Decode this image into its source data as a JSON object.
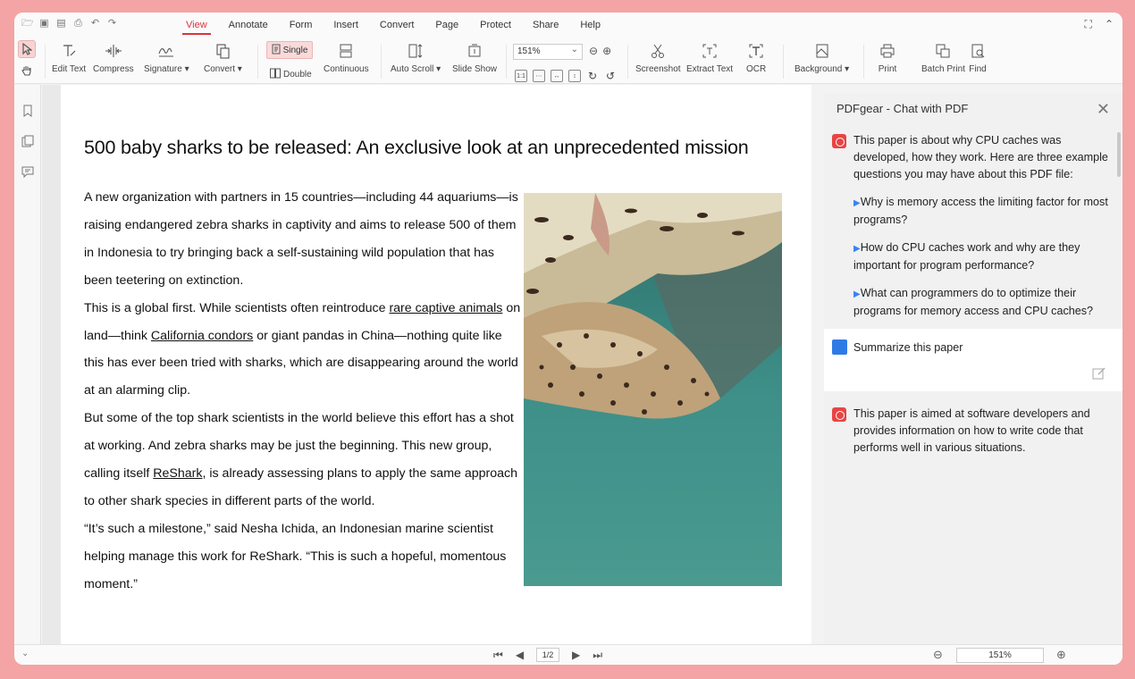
{
  "menubar": {
    "menus": [
      "View",
      "Annotate",
      "Form",
      "Insert",
      "Convert",
      "Page",
      "Protect",
      "Share",
      "Help"
    ],
    "active": "View"
  },
  "toolbar": {
    "edit_text": "Edit Text",
    "compress": "Compress",
    "signature": "Signature ▾",
    "convert": "Convert ▾",
    "single": "Single",
    "double": "Double",
    "continuous": "Continuous",
    "auto_scroll": "Auto Scroll ▾",
    "slide_show": "Slide Show",
    "zoom_value": "151%",
    "screenshot": "Screenshot",
    "extract_text": "Extract Text",
    "ocr": "OCR",
    "background": "Background ▾",
    "print": "Print",
    "batch_print": "Batch Print",
    "find": "Find"
  },
  "document": {
    "title": "500 baby sharks to be released: An exclusive look at an unprecedented mission",
    "p1": "A new organization with partners in 15 countries—including 44 aquariums—is raising endangered zebra sharks in captivity and aims to release 500 of them in Indonesia to try bringing back a self-sustaining wild population that has been teetering on extinction.",
    "p2_a": "This is a global first. While scientists often reintroduce ",
    "p2_link1": "rare captive animals",
    "p2_b": " on land—think ",
    "p2_link2": "California condors",
    "p2_c": " or giant pandas in China—nothing quite like this has ever been tried with sharks, which are disappearing around the world at an alarming clip.",
    "p3_a": "But some of the top shark scientists in the world believe this effort has a shot at working. And zebra sharks may be just the beginning. This new group, calling itself ",
    "p3_link": "ReShark",
    "p3_b": ", is already assessing plans to apply the same approach to other shark species in different parts of the world.",
    "p4": "“It’s such a milestone,” said Nesha Ichida, an Indonesian marine scientist helping manage this work for ReShark. “This is such a hopeful, momentous moment.”"
  },
  "chat": {
    "title": "PDFgear - Chat with PDF",
    "intro": "This paper is about why CPU caches was developed, how they work. Here are three example questions you may have about this PDF file:",
    "questions": [
      "Why is memory access the limiting factor for most programs?",
      "How do CPU caches work and why are they important for program performance?",
      "What can programmers do to optimize their programs for memory access and CPU caches?"
    ],
    "user_message": "Summarize this paper",
    "answer": "This paper is aimed at software developers and provides information on how to write code that performs well in various situations."
  },
  "bottom": {
    "page_indicator": "1/2",
    "zoom": "151%"
  },
  "colors": {
    "accent": "#d9343a",
    "bot_icon": "#e94444",
    "user_icon": "#2f7be5",
    "frame": "#f4a4a4"
  }
}
